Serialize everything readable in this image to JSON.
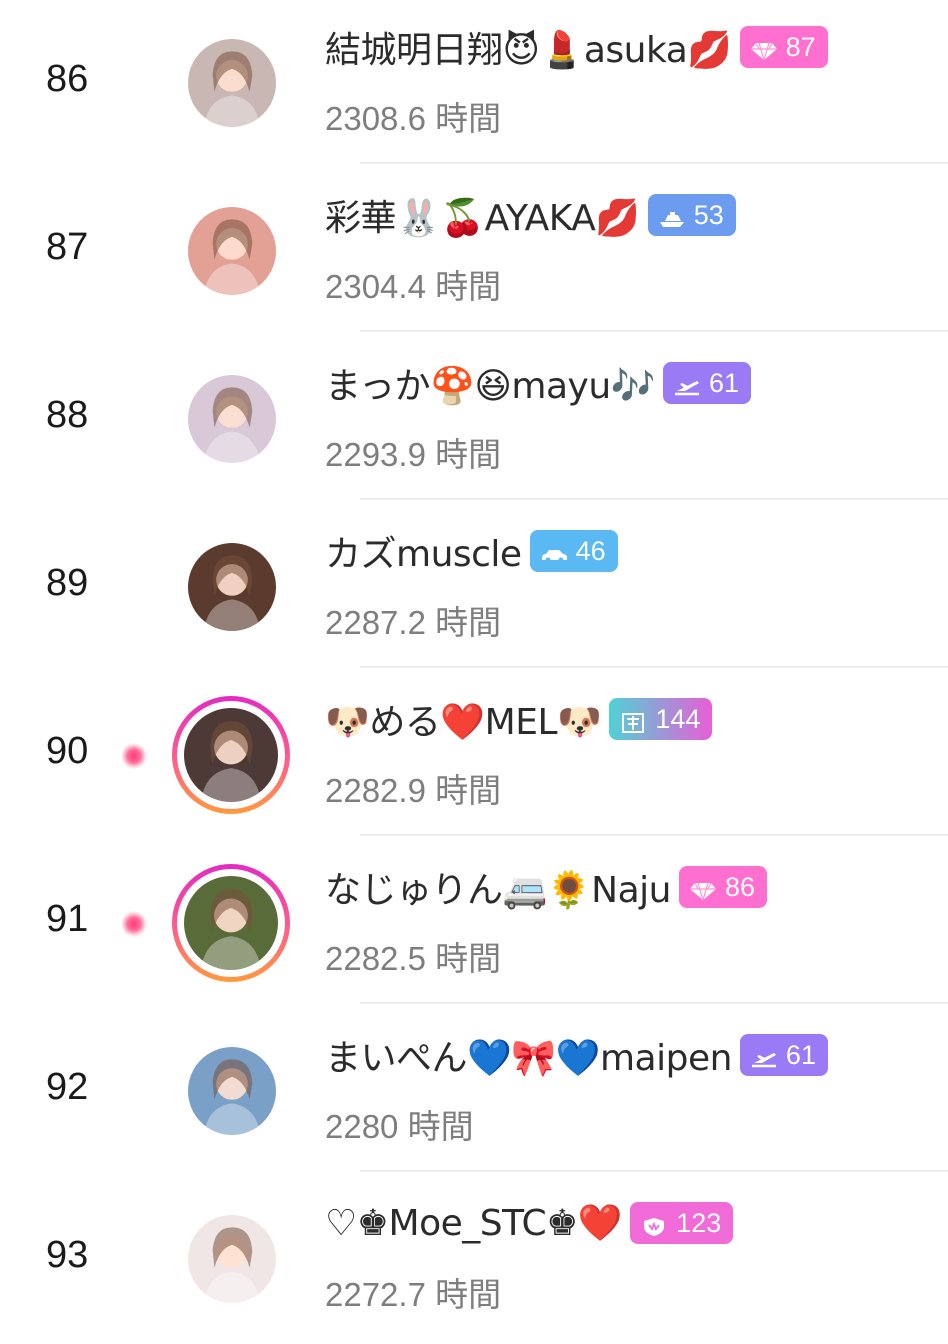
{
  "unit": "時間",
  "rows": [
    {
      "rank": "86",
      "name": "結城明日翔😈💄asuka💋",
      "badge": "87",
      "badge_icon": "diamond-icon",
      "badge_color": "#ff6fd0",
      "hours": "2308.6",
      "live": false,
      "avatar_color": "#c9b7b4"
    },
    {
      "rank": "87",
      "name": "彩華🐰🍒AYAKA💋",
      "badge": "53",
      "badge_icon": "ship-icon",
      "badge_color": "#6b9cf0",
      "hours": "2304.4",
      "live": false,
      "avatar_color": "#e3a196"
    },
    {
      "rank": "88",
      "name": "まっか🍄😆mayu🎶",
      "badge": "61",
      "badge_icon": "plane-icon",
      "badge_color": "#9a7af5",
      "hours": "2293.9",
      "live": false,
      "avatar_color": "#d8c8d8"
    },
    {
      "rank": "89",
      "name": "カズmuscle",
      "badge": "46",
      "badge_icon": "car-icon",
      "badge_color": "#5ab8f2",
      "hours": "2287.2",
      "live": false,
      "avatar_color": "#5a3b2d"
    },
    {
      "rank": "90",
      "name": "🐶める❤️MEL🐶",
      "badge": "144",
      "badge_icon": "castle-icon",
      "badge_color": "#4fd2d6",
      "badge_color2": "#e85ed6",
      "hours": "2282.9",
      "live": true,
      "avatar_color": "#4d3a36"
    },
    {
      "rank": "91",
      "name": "なじゅりん🚐🌻Naju",
      "badge": "86",
      "badge_icon": "diamond-icon",
      "badge_color": "#ff6fd0",
      "hours": "2282.5",
      "live": true,
      "avatar_color": "#5a6b3a"
    },
    {
      "rank": "92",
      "name": "まいぺん💙🎀💙maipen",
      "badge": "61",
      "badge_icon": "plane-icon",
      "badge_color": "#9a7af5",
      "hours": "2280",
      "live": false,
      "avatar_color": "#7aa0c8"
    },
    {
      "rank": "93",
      "name": "♡♚Moe_STC♚❤️",
      "badge": "123",
      "badge_icon": "shield-icon",
      "badge_color": "#f06ad8",
      "hours": "2272.7",
      "live": false,
      "avatar_color": "#f0e6e6"
    }
  ]
}
